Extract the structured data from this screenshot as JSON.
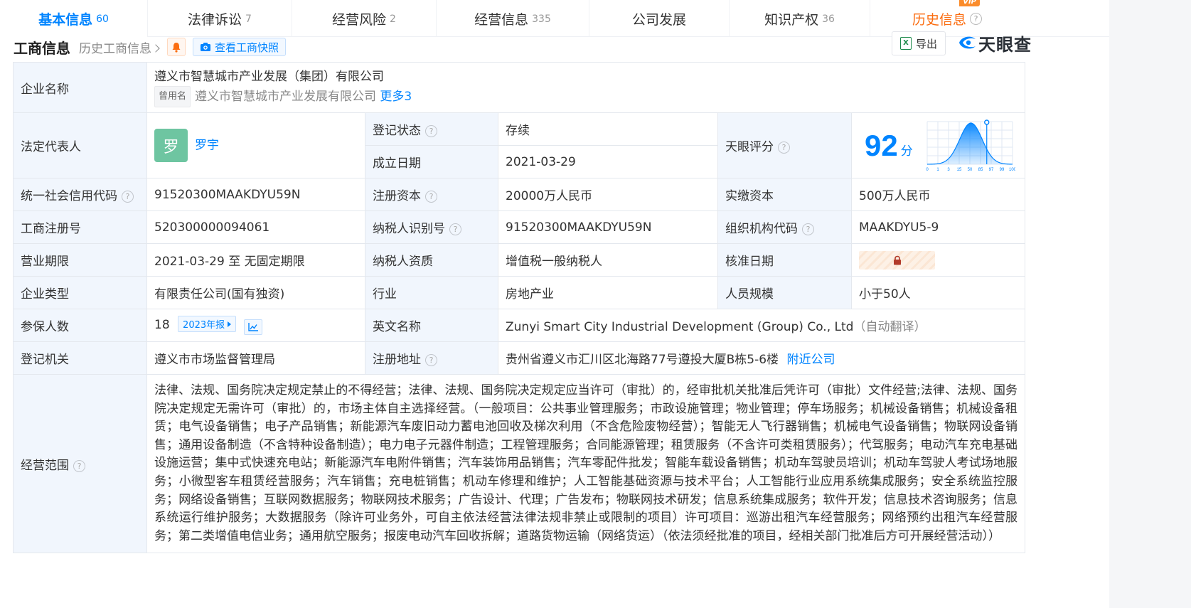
{
  "tabs": [
    {
      "label": "基本信息",
      "count": "60",
      "active": true
    },
    {
      "label": "法律诉讼",
      "count": "7"
    },
    {
      "label": "经营风险",
      "count": "2"
    },
    {
      "label": "经营信息",
      "count": "335"
    },
    {
      "label": "公司发展",
      "count": ""
    },
    {
      "label": "知识产权",
      "count": "36"
    },
    {
      "label": "历史信息",
      "count": "",
      "badge": "VIP"
    }
  ],
  "section": {
    "title": "工商信息",
    "history_link": "历史工商信息",
    "snapshot_label": "查看工商快照",
    "export_label": "导出",
    "logo_text": "天眼查"
  },
  "company": {
    "name_label": "企业名称",
    "name": "遵义市智慧城市产业发展（集团）有限公司",
    "used_name_tag": "曾用名",
    "used_name": "遵义市智慧城市产业发展有限公司",
    "more_label": "更多3",
    "legal_rep_label": "法定代表人",
    "legal_rep_avatar": "罗",
    "legal_rep": "罗宇",
    "status_label": "登记状态",
    "status": "存续",
    "found_date_label": "成立日期",
    "found_date": "2021-03-29",
    "score_label": "天眼评分",
    "score": "92",
    "score_unit": "分",
    "credit_code_label": "统一社会信用代码",
    "credit_code": "91520300MAAKDYU59N",
    "reg_capital_label": "注册资本",
    "reg_capital": "20000万人民币",
    "paid_capital_label": "实缴资本",
    "paid_capital": "500万人民币",
    "reg_no_label": "工商注册号",
    "reg_no": "520300000094061",
    "taxpayer_id_label": "纳税人识别号",
    "taxpayer_id": "91520300MAAKDYU59N",
    "org_code_label": "组织机构代码",
    "org_code": "MAAKDYU5-9",
    "term_label": "营业期限",
    "term": "2021-03-29 至 无固定期限",
    "taxpayer_qual_label": "纳税人资质",
    "taxpayer_qual": "增值税一般纳税人",
    "approve_date_label": "核准日期",
    "type_label": "企业类型",
    "type": "有限责任公司(国有独资)",
    "industry_label": "行业",
    "industry": "房地产业",
    "staff_size_label": "人员规模",
    "staff_size": "小于50人",
    "insured_label": "参保人数",
    "insured": "18",
    "insured_year_btn": "2023年报",
    "english_name_label": "英文名称",
    "english_name": "Zunyi Smart City Industrial Development (Group) Co., Ltd",
    "auto_translate": "（自动翻译）",
    "authority_label": "登记机关",
    "authority": "遵义市市场监督管理局",
    "address_label": "注册地址",
    "address": "贵州省遵义市汇川区北海路77号遵投大厦B栋5-6楼",
    "nearby_label": "附近公司",
    "scope_label": "经营范围",
    "scope": "法律、法规、国务院决定规定禁止的不得经营；法律、法规、国务院决定规定应当许可（审批）的，经审批机关批准后凭许可（审批）文件经营;法律、法规、国务院决定规定无需许可（审批）的，市场主体自主选择经营。（一般项目：公共事业管理服务；市政设施管理；物业管理；停车场服务；机械设备销售；机械设备租赁；电气设备销售；电子产品销售；新能源汽车废旧动力蓄电池回收及梯次利用（不含危险废物经营）；智能无人飞行器销售；机械电气设备销售；物联网设备销售；通用设备制造（不含特种设备制造）；电力电子元器件制造；工程管理服务；合同能源管理；租赁服务（不含许可类租赁服务）；代驾服务；电动汽车充电基础设施运营；集中式快速充电站；新能源汽车电附件销售；汽车装饰用品销售；汽车零配件批发；智能车载设备销售；机动车驾驶员培训；机动车驾驶人考试场地服务；小微型客车租赁经营服务；汽车销售；充电桩销售；机动车修理和维护；人工智能基础资源与技术平台；人工智能行业应用系统集成服务；安全系统监控服务；网络设备销售；互联网数据服务；物联网技术服务；广告设计、代理；广告发布；物联网技术研发；信息系统集成服务；软件开发；信息技术咨询服务；信息系统运行维护服务；大数据服务（除许可业务外，可自主依法经营法律法规非禁止或限制的项目）许可项目：巡游出租汽车经营服务；网络预约出租汽车经营服务；第二类增值电信业务；通用航空服务；报废电动汽车回收拆解；道路货物运输（网络货运）（依法须经批准的项目，经相关部门批准后方可开展经营活动））"
  },
  "score_chart": {
    "x_ticks": [
      "0",
      "1",
      "3",
      "15",
      "50",
      "85",
      "97",
      "99",
      "100"
    ],
    "marker_value": "92",
    "colors": {
      "curve": "#0084ff",
      "grid": "#dfe7f3"
    }
  },
  "colors": {
    "accent": "#0084ff",
    "status_green": "#1aa363",
    "history_orange": "#fb6d11",
    "label_bg": "#f1f6fd"
  },
  "icons": {
    "bell": "bell-icon",
    "camera": "camera-icon",
    "excel": "excel-icon",
    "lock": "lock-icon",
    "trend": "trend-chart-icon"
  }
}
